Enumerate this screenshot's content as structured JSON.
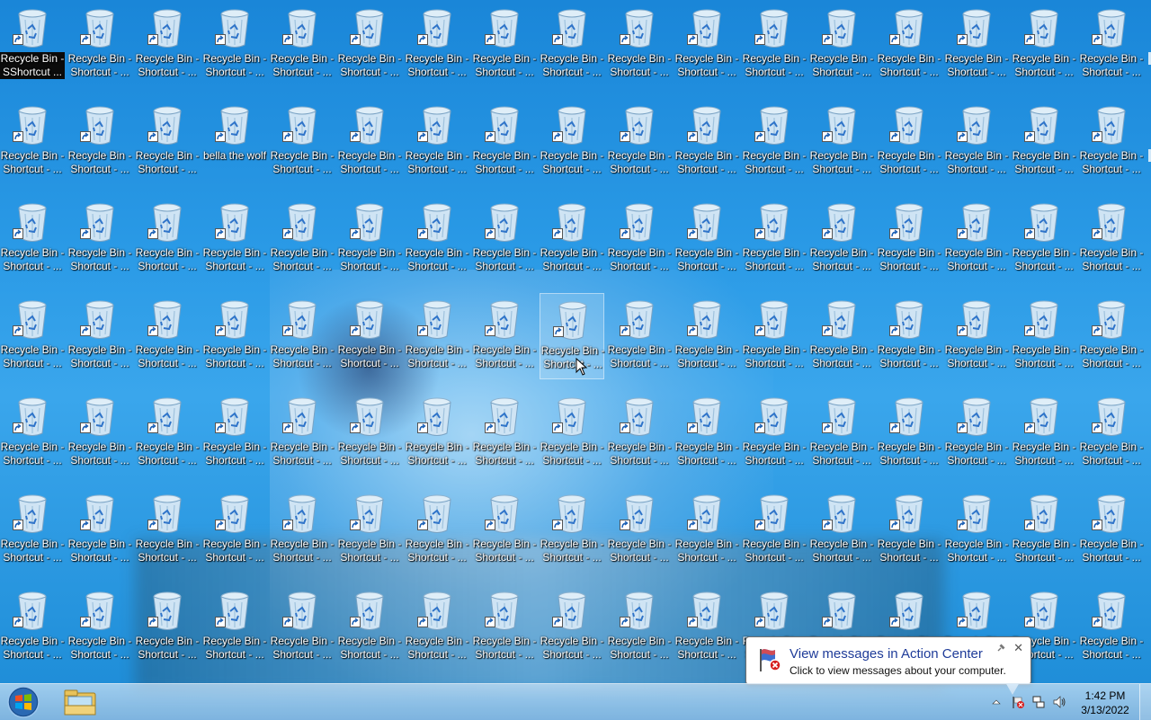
{
  "desktop": {
    "columns": 17,
    "rows": 7,
    "default_label": "Recycle Bin - Shortcut - ...",
    "icons": [
      {
        "row": 0,
        "col": 0,
        "label": "Recycle Bin - SShortcut ...",
        "selected": true
      },
      {
        "row": 1,
        "col": 3,
        "label": "bella the wolf"
      },
      {
        "row": 3,
        "col": 8,
        "label": "Recycle Bin - Shortcut - ...",
        "hover": true
      }
    ]
  },
  "taskbar": {
    "start_label": "Start",
    "pinned": [
      {
        "name": "Windows Explorer"
      }
    ],
    "clock": {
      "time": "1:42 PM",
      "date": "3/13/2022"
    },
    "tray_icons": [
      "show-hidden-icons",
      "action-center-flag-icon",
      "network-icon",
      "volume-icon"
    ]
  },
  "notification": {
    "title": "View messages in Action Center",
    "message": "Click to view messages about your computer."
  },
  "colors": {
    "desktop_blue": "#1a86d8",
    "notification_title": "#1f3c99"
  }
}
